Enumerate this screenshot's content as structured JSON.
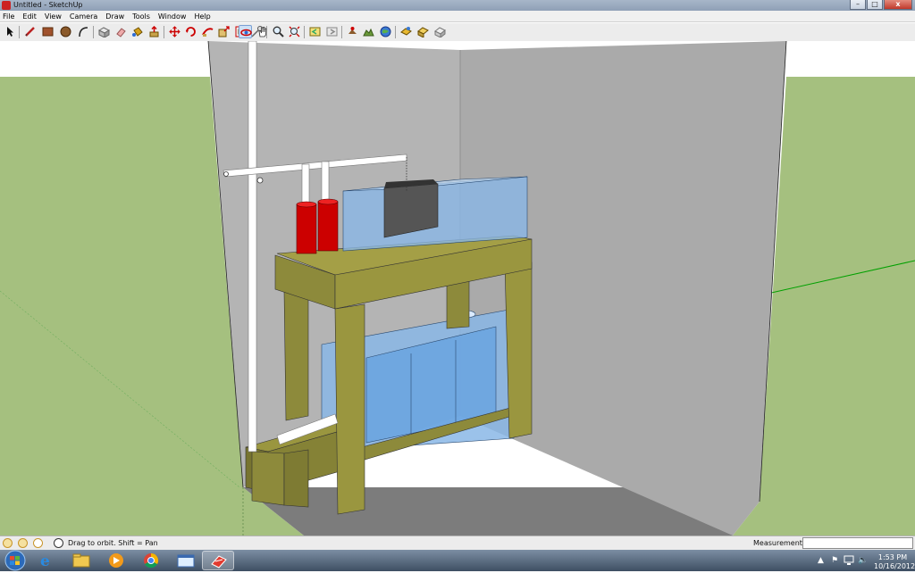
{
  "window": {
    "title": "Untitled - SketchUp",
    "min_label": "–",
    "max_label": "□",
    "close_label": "x"
  },
  "menu": [
    "File",
    "Edit",
    "View",
    "Camera",
    "Draw",
    "Tools",
    "Window",
    "Help"
  ],
  "toolbar": {
    "tools": [
      {
        "name": "select-icon",
        "active": false
      },
      {
        "name": "pencil-line-icon",
        "active": false
      },
      {
        "name": "rectangle-icon",
        "active": false
      },
      {
        "name": "circle-icon",
        "active": false
      },
      {
        "name": "arc-icon",
        "active": false
      },
      {
        "name": "make-component-icon",
        "active": false
      },
      {
        "name": "eraser-icon",
        "active": false
      },
      {
        "name": "paint-bucket-icon",
        "active": false
      },
      {
        "name": "push-pull-icon",
        "active": false
      },
      {
        "name": "move-icon",
        "active": false
      },
      {
        "name": "rotate-icon",
        "active": false
      },
      {
        "name": "follow-me-icon",
        "active": false
      },
      {
        "name": "scale-icon",
        "active": false
      },
      {
        "name": "offset-icon",
        "active": false
      },
      {
        "name": "tape-measure-icon",
        "active": false
      },
      {
        "name": "orbit-icon",
        "active": true
      },
      {
        "name": "pan-icon",
        "active": false
      },
      {
        "name": "zoom-icon",
        "active": false
      },
      {
        "name": "zoom-extents-icon",
        "active": false
      },
      {
        "name": "previous-view-icon",
        "active": false
      },
      {
        "name": "next-view-icon",
        "active": false
      },
      {
        "name": "add-location-icon",
        "active": false
      },
      {
        "name": "toggle-terrain-icon",
        "active": false
      },
      {
        "name": "get-models-icon",
        "active": false
      },
      {
        "name": "share-model-icon",
        "active": false
      },
      {
        "name": "get-photo-texture-icon",
        "active": false
      },
      {
        "name": "preview-google-earth-icon",
        "active": false
      }
    ]
  },
  "status": {
    "text": "Drag to orbit.  Shift = Pan",
    "measurements_label": "Measurements",
    "measurements_value": ""
  },
  "taskbar": {
    "apps": [
      "ie-icon",
      "explorer-icon",
      "media-player-icon",
      "chrome-icon",
      "window-icon",
      "sketchup-icon"
    ],
    "active_app": "sketchup-icon",
    "clock_time": "1:53 PM",
    "clock_date": "10/16/2012"
  },
  "colors": {
    "sky": "#ffffff",
    "ground": "#a5c07f",
    "wall_left": "#b4b4b4",
    "wall_right": "#aaaaaa",
    "floor": "#7c7c7c",
    "wood": "#8d8a3b",
    "glass": "#7fb3ea",
    "pipe": "#ffffff",
    "canister": "#cc0000",
    "axis_green": "#00a000"
  }
}
